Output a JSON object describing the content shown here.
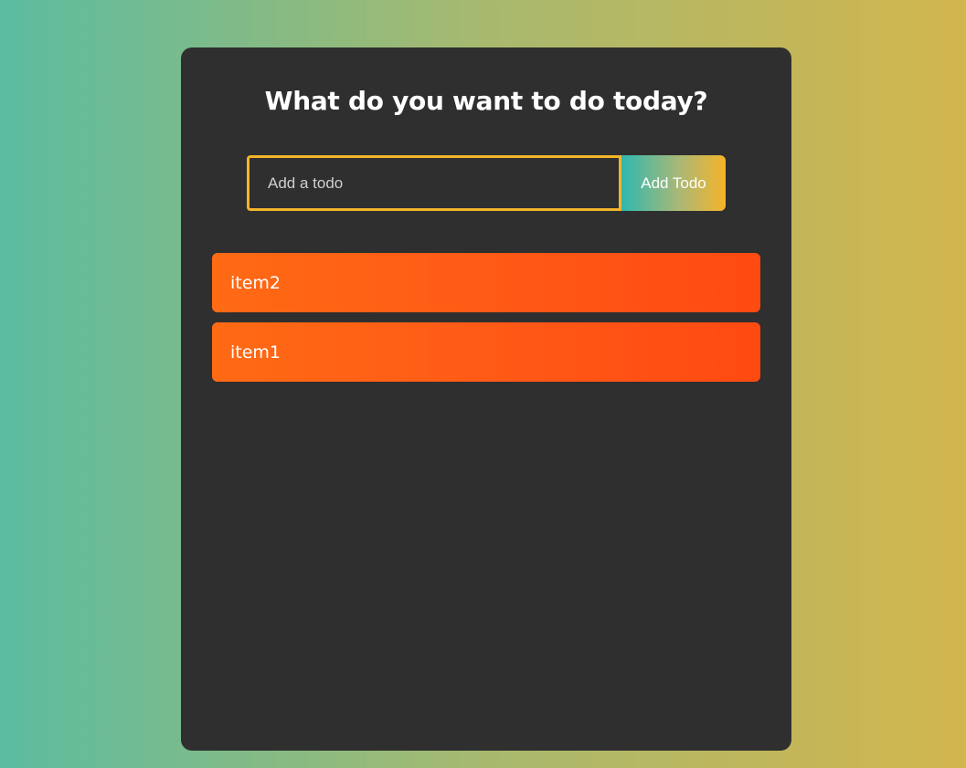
{
  "page": {
    "title": "What do you want to do today?"
  },
  "form": {
    "input_value": "",
    "input_placeholder": "Add a todo",
    "add_button_label": "Add Todo"
  },
  "todos": [
    {
      "text": "item2"
    },
    {
      "text": "item1"
    }
  ],
  "colors": {
    "background_gradient": [
      "#5bbca0",
      "#d2b54d"
    ],
    "card": "#2f2f2f",
    "input_border": "#f2b42a",
    "button_gradient": [
      "#2fb8b0",
      "#f5b42a"
    ],
    "todo_gradient": [
      "#ff6a14",
      "#ff4a12"
    ]
  }
}
